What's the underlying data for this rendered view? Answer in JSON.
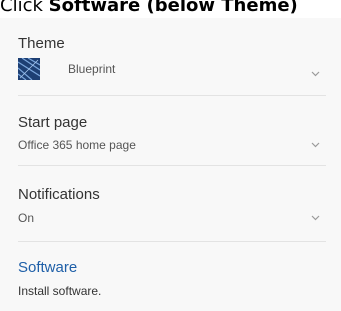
{
  "caption": {
    "prefix": "Click ",
    "bold": "Software",
    "suffix": " (below Theme)"
  },
  "settings": {
    "theme": {
      "label": "Theme",
      "value": "Blueprint"
    },
    "start_page": {
      "label": "Start page",
      "value": "Office 365 home page"
    },
    "notifications": {
      "label": "Notifications",
      "value": "On"
    },
    "software": {
      "label": "Software",
      "value": "Install software."
    }
  },
  "colors": {
    "link": "#1e5fa8",
    "panel": "#f8f8f8",
    "divider": "#e3e3e3"
  },
  "icons": {
    "chevron": "chevron-down-icon",
    "theme_thumb": "blueprint-theme-thumbnail"
  }
}
